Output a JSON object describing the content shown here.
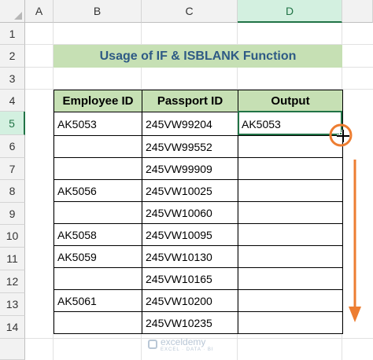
{
  "columns": [
    "A",
    "B",
    "C",
    "D"
  ],
  "selected_column": "D",
  "rows": [
    "1",
    "2",
    "3",
    "4",
    "5",
    "6",
    "7",
    "8",
    "9",
    "10",
    "11",
    "12",
    "13",
    "14"
  ],
  "selected_row": "5",
  "title": "Usage of IF & ISBLANK Function",
  "table": {
    "headers": [
      "Employee ID",
      "Passport ID",
      "Output"
    ],
    "rows": [
      [
        "AK5053",
        "245VW99204",
        "AK5053"
      ],
      [
        "",
        "245VW99552",
        ""
      ],
      [
        "",
        "245VW99909",
        ""
      ],
      [
        "AK5056",
        "245VW10025",
        ""
      ],
      [
        "",
        "245VW10060",
        ""
      ],
      [
        "AK5058",
        "245VW10095",
        ""
      ],
      [
        "AK5059",
        "245VW10130",
        ""
      ],
      [
        "",
        "245VW10165",
        ""
      ],
      [
        "AK5061",
        "245VW10200",
        ""
      ],
      [
        "",
        "245VW10235",
        ""
      ]
    ]
  },
  "watermark": {
    "name": "exceldemy",
    "tagline": "EXCEL · DATA · BI"
  },
  "colors": {
    "accent": "#217346",
    "title_fill": "#c6e0b4",
    "title_text": "#2e5a85",
    "annotation": "#ed7d31"
  },
  "icons": {
    "cursor": "fill-cross-cursor-icon",
    "arrow": "down-arrow-icon",
    "highlight": "fill-handle-highlight-circle"
  }
}
